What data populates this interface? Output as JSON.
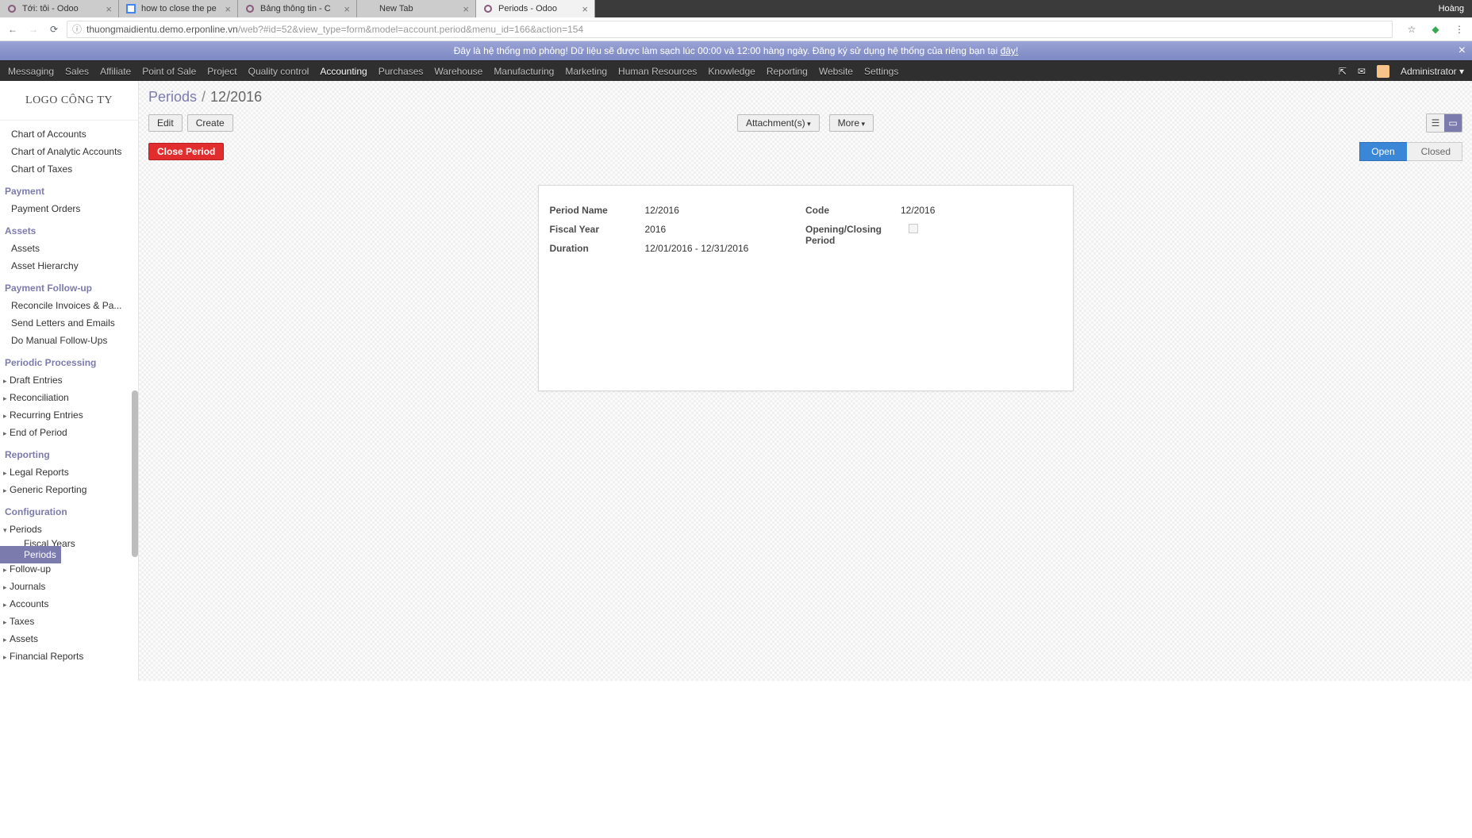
{
  "browser": {
    "user": "Hoàng",
    "tabs": [
      {
        "label": "Tới: tôi - Odoo",
        "favicon": "odoo"
      },
      {
        "label": "how to close the pe",
        "favicon": "se"
      },
      {
        "label": "Bảng thông tin - C",
        "favicon": "odoo"
      },
      {
        "label": "New Tab",
        "favicon": "none"
      },
      {
        "label": "Periods - Odoo",
        "favicon": "odoo",
        "active": true
      }
    ],
    "url_host": "thuongmaidientu.demo.erponline.vn",
    "url_path": "/web?#id=52&view_type=form&model=account.period&menu_id=166&action=154"
  },
  "notice": {
    "text": "Đây là hệ thống mô phỏng! Dữ liệu sẽ được làm sạch lúc 00:00 và 12:00 hàng ngày. Đăng ký sử dụng hệ thống của riêng bạn tại ",
    "link": "đây!"
  },
  "nav": {
    "items": [
      "Messaging",
      "Sales",
      "Affiliate",
      "Point of Sale",
      "Project",
      "Quality control",
      "Accounting",
      "Purchases",
      "Warehouse",
      "Manufacturing",
      "Marketing",
      "Human Resources",
      "Knowledge",
      "Reporting",
      "Website",
      "Settings"
    ],
    "active": "Accounting",
    "user": "Administrator"
  },
  "company_logo": "LOGO CÔNG TY",
  "sidebar": {
    "s1_items": [
      "Chart of Accounts",
      "Chart of Analytic Accounts",
      "Chart of Taxes"
    ],
    "s2_head": "Payment",
    "s2_items": [
      "Payment Orders"
    ],
    "s3_head": "Assets",
    "s3_items": [
      "Assets",
      "Asset Hierarchy"
    ],
    "s4_head": "Payment Follow-up",
    "s4_items": [
      "Reconcile Invoices & Pa...",
      "Send Letters and Emails",
      "Do Manual Follow-Ups"
    ],
    "s5_head": "Periodic Processing",
    "s5_items": [
      "Draft Entries",
      "Reconciliation",
      "Recurring Entries",
      "End of Period"
    ],
    "s6_head": "Reporting",
    "s6_items": [
      "Legal Reports",
      "Generic Reporting"
    ],
    "s7_head": "Configuration",
    "s7_items": [
      "Periods",
      "Follow-up",
      "Journals",
      "Accounts",
      "Taxes",
      "Assets",
      "Financial Reports"
    ],
    "s7_sub": [
      "Fiscal Years",
      "Periods"
    ]
  },
  "breadcrumb": {
    "root": "Periods",
    "current": "12/2016"
  },
  "buttons": {
    "edit": "Edit",
    "create": "Create",
    "close_period": "Close Period",
    "attachments": "Attachment(s)",
    "more": "More"
  },
  "status": {
    "open": "Open",
    "closed": "Closed"
  },
  "form": {
    "labels": {
      "period_name": "Period Name",
      "fiscal_year": "Fiscal Year",
      "duration": "Duration",
      "code": "Code",
      "opening_closing": "Opening/Closing Period"
    },
    "values": {
      "period_name": "12/2016",
      "fiscal_year": "2016",
      "duration_from": "12/01/2016",
      "duration_to": "12/31/2016",
      "code": "12/2016"
    }
  }
}
